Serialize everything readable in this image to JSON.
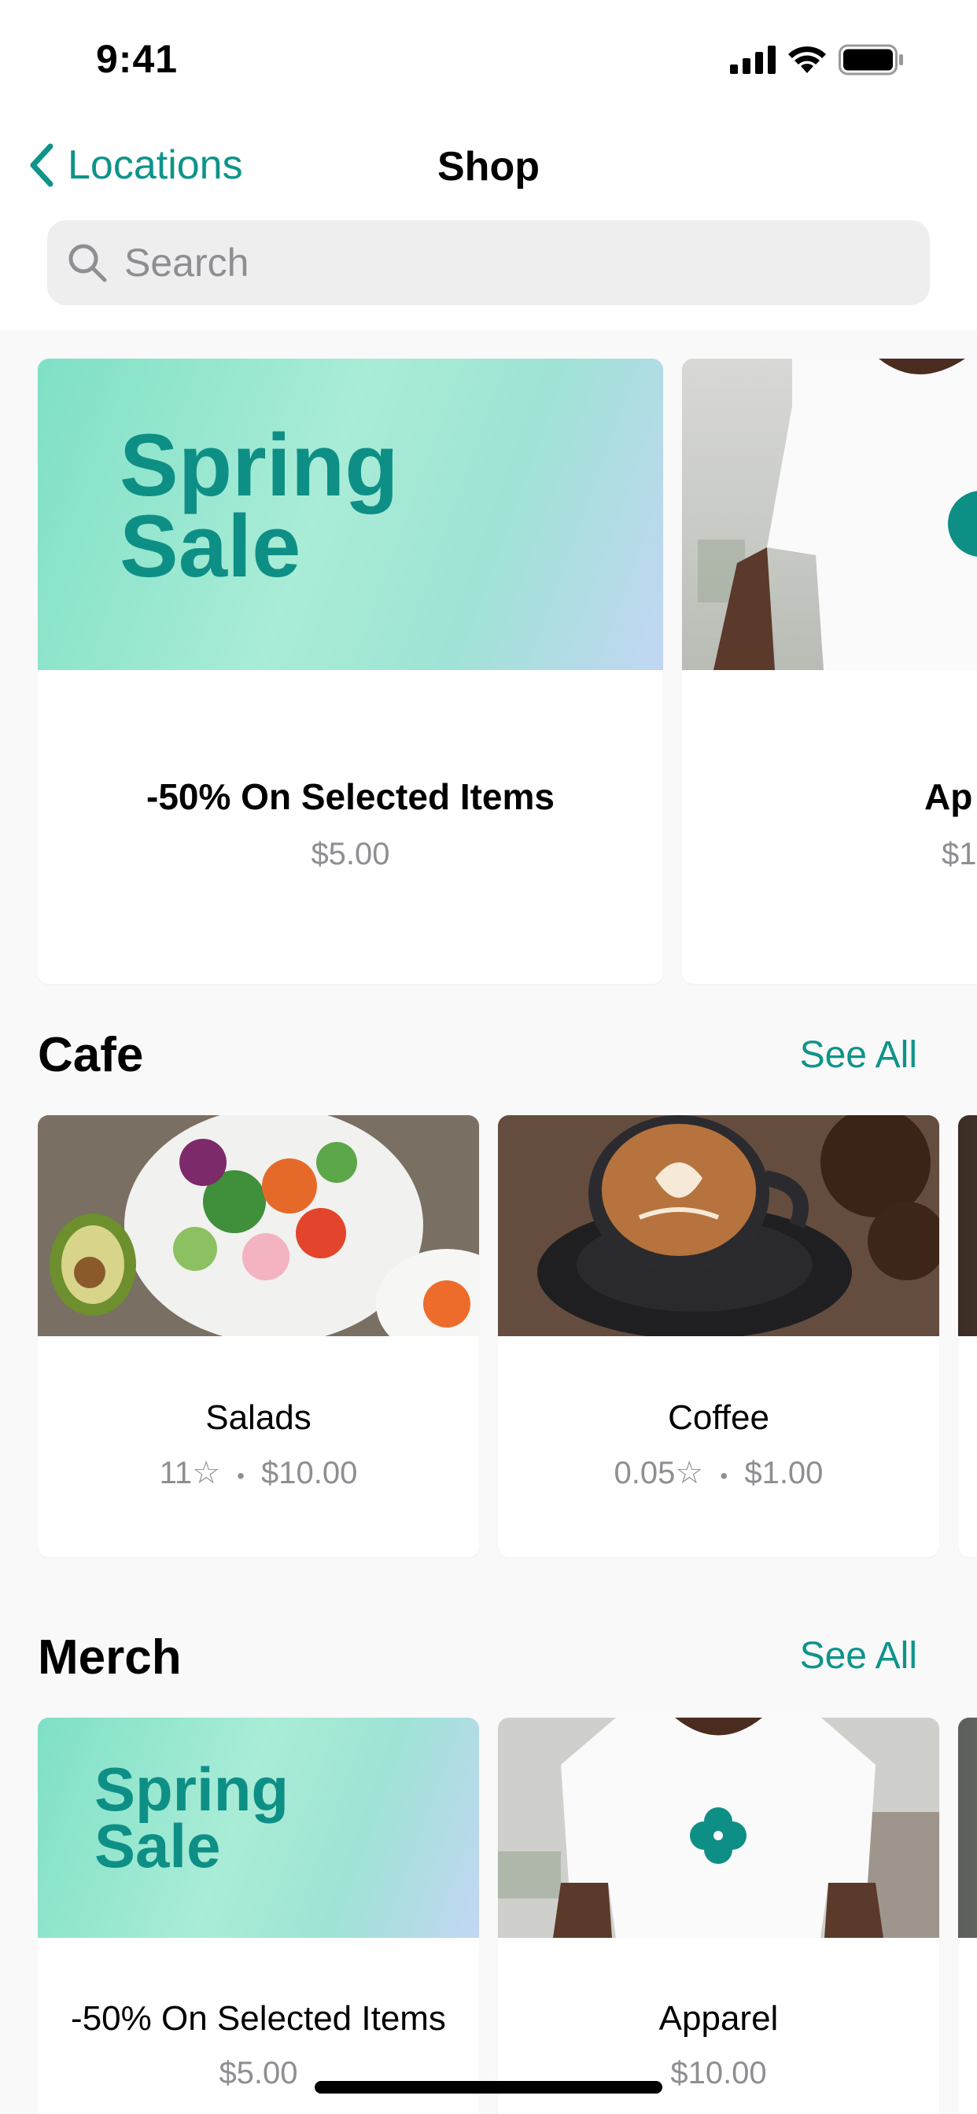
{
  "status_bar": {
    "time": "9:41"
  },
  "nav": {
    "back_label": "Locations",
    "title": "Shop"
  },
  "search": {
    "placeholder": "Search"
  },
  "featured": [
    {
      "image_text_line1": "Spring",
      "image_text_line2": "Sale",
      "title": "-50% On Selected Items",
      "price": "$5.00"
    },
    {
      "title": "Ap",
      "price": "$1"
    }
  ],
  "sections": [
    {
      "title": "Cafe",
      "see_all": "See All",
      "items": [
        {
          "title": "Salads",
          "rating": "11☆",
          "separator": "•",
          "price": "$10.00"
        },
        {
          "title": "Coffee",
          "rating": "0.05☆",
          "separator": "•",
          "price": "$1.00"
        }
      ]
    },
    {
      "title": "Merch",
      "see_all": "See All",
      "items": [
        {
          "image_text_line1": "Spring",
          "image_text_line2": "Sale",
          "title": "-50% On Selected Items",
          "price": "$5.00"
        },
        {
          "title": "Apparel",
          "price": "$10.00"
        }
      ]
    }
  ],
  "colors": {
    "accent": "#0e948a",
    "secondary_text": "#8e8e93",
    "background": "#f9f9f9"
  }
}
